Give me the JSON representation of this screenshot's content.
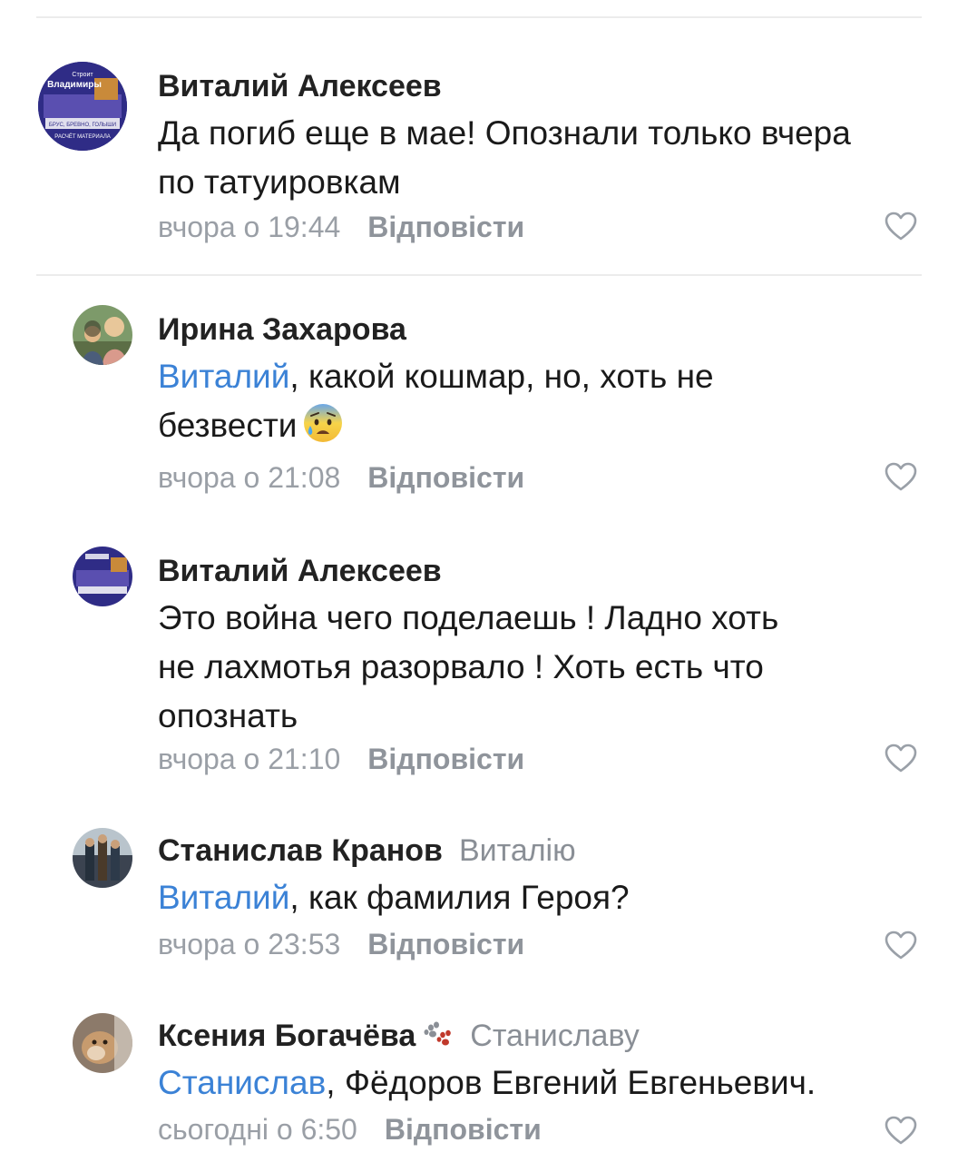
{
  "comments": [
    {
      "author": "Виталий Алексеев",
      "reply_to": "",
      "mention": "",
      "text_lines": [
        "Да погиб еще в мае! Опознали только вчера",
        "по татуировкам"
      ],
      "time": "вчора о 19:44",
      "reply_label": "Відповісти",
      "avatar_text": [
        "Строит",
        "Владимиры",
        "БРУС, БРЕВНО, ГОЛЫШИ",
        "РАСЧЁТ МАТЕРИАЛА"
      ]
    },
    {
      "author": "Ирина Захарова",
      "reply_to": "",
      "mention": "Виталий",
      "text_lines": [
        ", какой кошмар, но, хоть не",
        "безвести"
      ],
      "time": "вчора о 21:08",
      "reply_label": "Відповісти",
      "emoji": "anxious-face-with-sweat"
    },
    {
      "author": "Виталий Алексеев",
      "reply_to": "",
      "mention": "",
      "text_lines": [
        "Это война чего поделаешь ! Ладно хоть",
        "не лахмотья разорвало ! Хоть есть что",
        "опознать"
      ],
      "time": "вчора о 21:10",
      "reply_label": "Відповісти"
    },
    {
      "author": "Станислав Кранов",
      "reply_to": "Виталію",
      "mention": "Виталий",
      "text_lines": [
        ", как фамилия Героя?"
      ],
      "time": "вчора о 23:53",
      "reply_label": "Відповісти"
    },
    {
      "author": "Ксения Богачёва",
      "reply_to": "Станиславу",
      "mention": "Станислав",
      "text_lines": [
        ", Фёдоров Евгений Евгеньевич."
      ],
      "time": "сьогодні о 6:50",
      "reply_label": "Відповісти",
      "name_icon": "paw-prints-icon"
    }
  ],
  "colors": {
    "mention": "#3b82d6",
    "meta": "#9a9fa6",
    "author": "#222222"
  }
}
